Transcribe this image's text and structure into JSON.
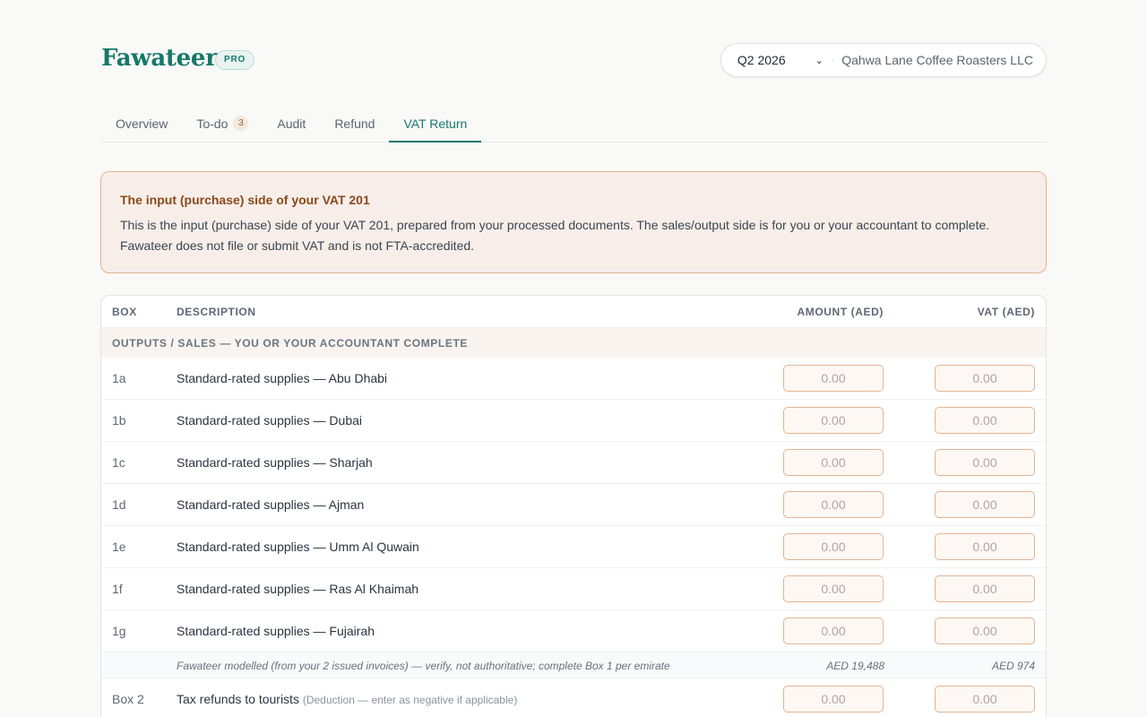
{
  "brand": {
    "name": "Fawateer",
    "badge": "PRO"
  },
  "period": {
    "selected": "Q2 2026",
    "company": "Qahwa Lane Coffee Roasters LLC"
  },
  "tabs": [
    {
      "label": "Overview"
    },
    {
      "label": "To-do",
      "count": "3"
    },
    {
      "label": "Audit"
    },
    {
      "label": "Refund"
    },
    {
      "label": "VAT Return"
    }
  ],
  "notice": {
    "title": "The input (purchase) side of your VAT 201",
    "body": "This is the input (purchase) side of your VAT 201, prepared from your processed documents. The sales/output side is for you or your accountant to complete. Fawateer does not file or submit VAT and is not FTA-accredited."
  },
  "table": {
    "headers": {
      "box": "BOX",
      "description": "DESCRIPTION",
      "amount": "AMOUNT (AED)",
      "vat": "VAT (AED)"
    },
    "section_title": "OUTPUTS / SALES — YOU OR YOUR ACCOUNTANT COMPLETE",
    "rows": [
      {
        "box": "1a",
        "description": "Standard-rated supplies — Abu Dhabi",
        "amount_placeholder": "0.00",
        "vat_placeholder": "0.00"
      },
      {
        "box": "1b",
        "description": "Standard-rated supplies — Dubai",
        "amount_placeholder": "0.00",
        "vat_placeholder": "0.00"
      },
      {
        "box": "1c",
        "description": "Standard-rated supplies — Sharjah",
        "amount_placeholder": "0.00",
        "vat_placeholder": "0.00"
      },
      {
        "box": "1d",
        "description": "Standard-rated supplies — Ajman",
        "amount_placeholder": "0.00",
        "vat_placeholder": "0.00"
      },
      {
        "box": "1e",
        "description": "Standard-rated supplies — Umm Al Quwain",
        "amount_placeholder": "0.00",
        "vat_placeholder": "0.00"
      },
      {
        "box": "1f",
        "description": "Standard-rated supplies — Ras Al Khaimah",
        "amount_placeholder": "0.00",
        "vat_placeholder": "0.00"
      },
      {
        "box": "1g",
        "description": "Standard-rated supplies — Fujairah",
        "amount_placeholder": "0.00",
        "vat_placeholder": "0.00"
      }
    ],
    "modelled_note": {
      "text": "Fawateer modelled (from your 2 issued invoices) — verify, not authoritative; complete Box 1 per emirate",
      "amount": "AED 19,488",
      "vat": "AED 974"
    },
    "box2": {
      "box": "Box 2",
      "description": "Tax refunds to tourists",
      "hint": "(Deduction — enter as negative if applicable)",
      "amount_placeholder": "0.00",
      "vat_placeholder": "0.00"
    }
  }
}
